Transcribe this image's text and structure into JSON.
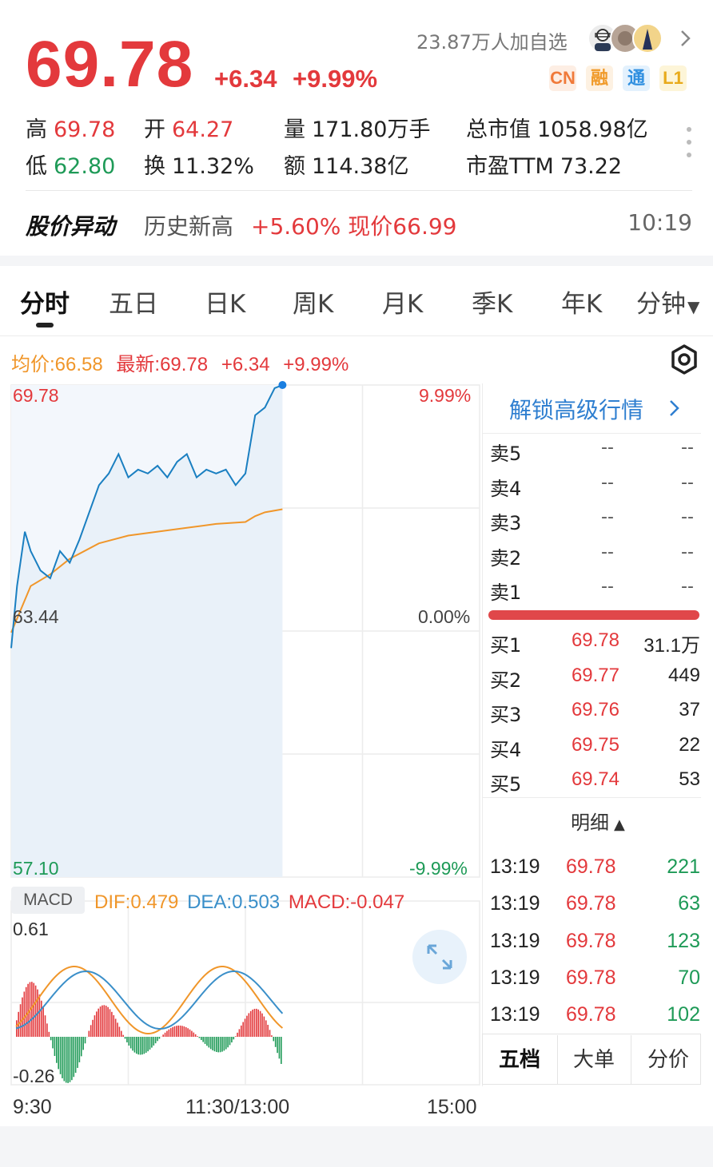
{
  "header": {
    "price": "69.78",
    "change": "+6.34",
    "change_pct": "+9.99%",
    "watchers": "23.87万人加自选",
    "badges": [
      "CN",
      "融",
      "通",
      "L1"
    ]
  },
  "stats": {
    "high_label": "高",
    "high": "69.78",
    "open_label": "开",
    "open": "64.27",
    "volume_label": "量",
    "volume": "171.80万手",
    "mktcap_label": "总市值",
    "mktcap": "1058.98亿",
    "low_label": "低",
    "low": "62.80",
    "turnover_label": "换",
    "turnover": "11.32%",
    "amount_label": "额",
    "amount": "114.38亿",
    "pe_label": "市盈TTM",
    "pe": "73.22"
  },
  "alert": {
    "title": "股价异动",
    "text": "历史新高",
    "detail": "+5.60% 现价66.99",
    "time": "10:19"
  },
  "tabs": [
    "分时",
    "五日",
    "日K",
    "周K",
    "月K",
    "季K",
    "年K",
    "分钟"
  ],
  "legend": {
    "avg": "均价:66.58",
    "latest": "最新:69.78",
    "chg": "+6.34",
    "pct": "+9.99%"
  },
  "axis": {
    "top_price": "69.78",
    "mid_price": "63.44",
    "bottom_price": "57.10",
    "top_pct": "9.99%",
    "mid_pct": "0.00%",
    "bottom_pct": "-9.99%",
    "macd_top": "0.61",
    "macd_bottom": "-0.26",
    "time_start": "9:30",
    "time_mid": "11:30/13:00",
    "time_end": "15:00"
  },
  "macd": {
    "label": "MACD",
    "dif": "DIF:0.479",
    "dea": "DEA:0.503",
    "macd": "MACD:-0.047"
  },
  "orderbook": {
    "unlock": "解锁高级行情",
    "asks": [
      {
        "label": "卖5",
        "price": "--",
        "vol": "--"
      },
      {
        "label": "卖4",
        "price": "--",
        "vol": "--"
      },
      {
        "label": "卖3",
        "price": "--",
        "vol": "--"
      },
      {
        "label": "卖2",
        "price": "--",
        "vol": "--"
      },
      {
        "label": "卖1",
        "price": "--",
        "vol": "--"
      }
    ],
    "bids": [
      {
        "label": "买1",
        "price": "69.78",
        "vol": "31.1万"
      },
      {
        "label": "买2",
        "price": "69.77",
        "vol": "449"
      },
      {
        "label": "买3",
        "price": "69.76",
        "vol": "37"
      },
      {
        "label": "买4",
        "price": "69.75",
        "vol": "22"
      },
      {
        "label": "买5",
        "price": "69.74",
        "vol": "53"
      }
    ],
    "detail_label": "明细",
    "ticks": [
      {
        "time": "13:19",
        "price": "69.78",
        "vol": "221"
      },
      {
        "time": "13:19",
        "price": "69.78",
        "vol": "63"
      },
      {
        "time": "13:19",
        "price": "69.78",
        "vol": "123"
      },
      {
        "time": "13:19",
        "price": "69.78",
        "vol": "70"
      },
      {
        "time": "13:19",
        "price": "69.78",
        "vol": "102"
      }
    ],
    "bottom_tabs": [
      "五档",
      "大单",
      "分价"
    ]
  },
  "colors": {
    "up": "#e3393c",
    "down": "#1e9a57",
    "price_line": "#1a7fc1",
    "avg_line": "#f0962a",
    "dea_line": "#3a8fc9"
  },
  "chart_data": {
    "type": "line",
    "title": "分时",
    "prev_close": 63.44,
    "ylim": [
      57.1,
      69.78
    ],
    "x_range": [
      "9:30",
      "15:00"
    ],
    "series": [
      {
        "name": "price",
        "x": [
          "9:30",
          "9:33",
          "9:37",
          "9:40",
          "9:45",
          "9:50",
          "9:55",
          "10:00",
          "10:05",
          "10:10",
          "10:15",
          "10:20",
          "10:25",
          "10:30",
          "10:35",
          "10:40",
          "10:45",
          "10:50",
          "10:55",
          "11:00",
          "11:05",
          "11:10",
          "11:15",
          "11:20",
          "11:25",
          "11:30",
          "13:05",
          "13:10",
          "13:15",
          "13:19"
        ],
        "values": [
          63.0,
          64.6,
          66.0,
          65.5,
          65.0,
          64.8,
          65.5,
          65.2,
          65.8,
          66.5,
          67.2,
          67.5,
          68.0,
          67.4,
          67.6,
          67.5,
          67.7,
          67.4,
          67.8,
          68.0,
          67.4,
          67.6,
          67.5,
          67.6,
          67.2,
          67.5,
          69.0,
          69.2,
          69.7,
          69.78
        ]
      },
      {
        "name": "avg",
        "x": [
          "9:30",
          "9:40",
          "9:50",
          "10:00",
          "10:15",
          "10:30",
          "10:45",
          "11:00",
          "11:15",
          "11:30",
          "13:05",
          "13:10",
          "13:19"
        ],
        "values": [
          63.4,
          64.6,
          64.9,
          65.3,
          65.7,
          65.9,
          66.0,
          66.1,
          66.2,
          66.25,
          66.4,
          66.5,
          66.58
        ]
      }
    ]
  }
}
